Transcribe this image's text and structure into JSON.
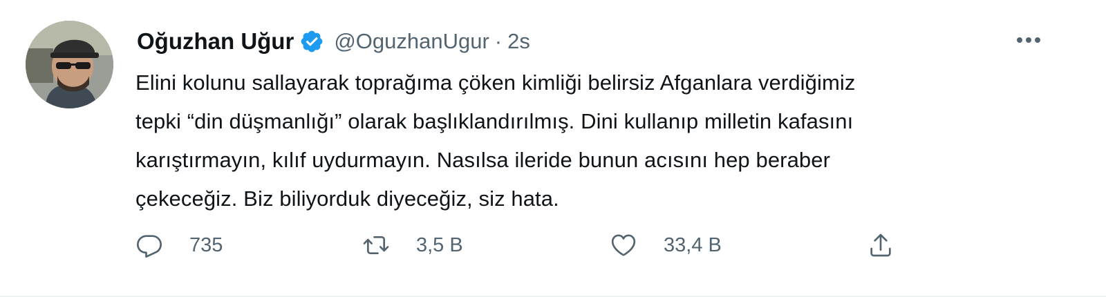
{
  "tweet": {
    "author": {
      "display_name": "Oğuzhan Uğur",
      "handle": "@OguzhanUgur",
      "verified": true,
      "avatar_icon": "profile-photo"
    },
    "separator": "·",
    "time": "2s",
    "text_lines": [
      "Elini kolunu sallayarak toprağıma çöken kimliği belirsiz Afganlara verdiğimiz",
      "tepki “din düşmanlığı” olarak başlıklandırılmış. Dini kullanıp milletin kafasını",
      "karıştırmayın, kılıf uydurmayın. Nasılsa ileride bunun acısını hep beraber",
      "çekeceğiz. Biz biliyorduk diyeceğiz, siz hata."
    ],
    "actions": {
      "reply": {
        "icon": "reply-icon",
        "count": "735"
      },
      "retweet": {
        "icon": "retweet-icon",
        "count": "3,5 B"
      },
      "like": {
        "icon": "heart-icon",
        "count": "33,4 B"
      },
      "share": {
        "icon": "share-icon"
      }
    },
    "more_icon": "more-icon"
  },
  "colors": {
    "text_primary": "#0f1419",
    "text_secondary": "#536471",
    "verified": "#1d9bf0",
    "border": "#eff3f4"
  }
}
